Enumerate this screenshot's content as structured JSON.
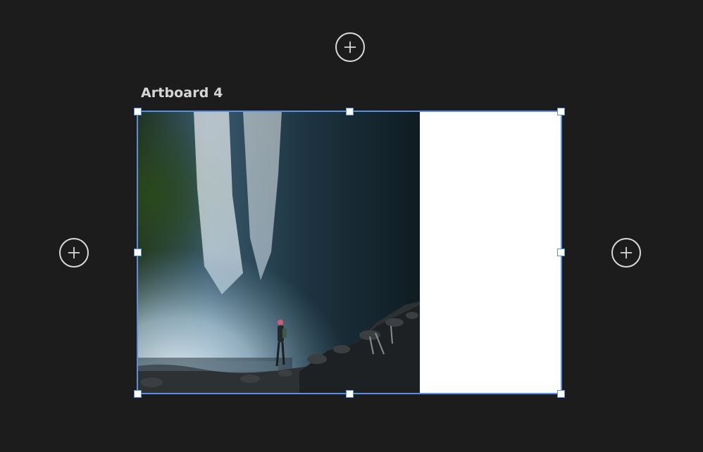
{
  "artboard": {
    "title": "Artboard 4",
    "image_icon": "waterfall-photo",
    "fill_color": "#ffffff"
  },
  "canvas": {
    "background": "#1c1c1c"
  },
  "selection": {
    "color": "#5a8fe6"
  },
  "add_buttons": {
    "icon": "plus-circle-icon"
  }
}
